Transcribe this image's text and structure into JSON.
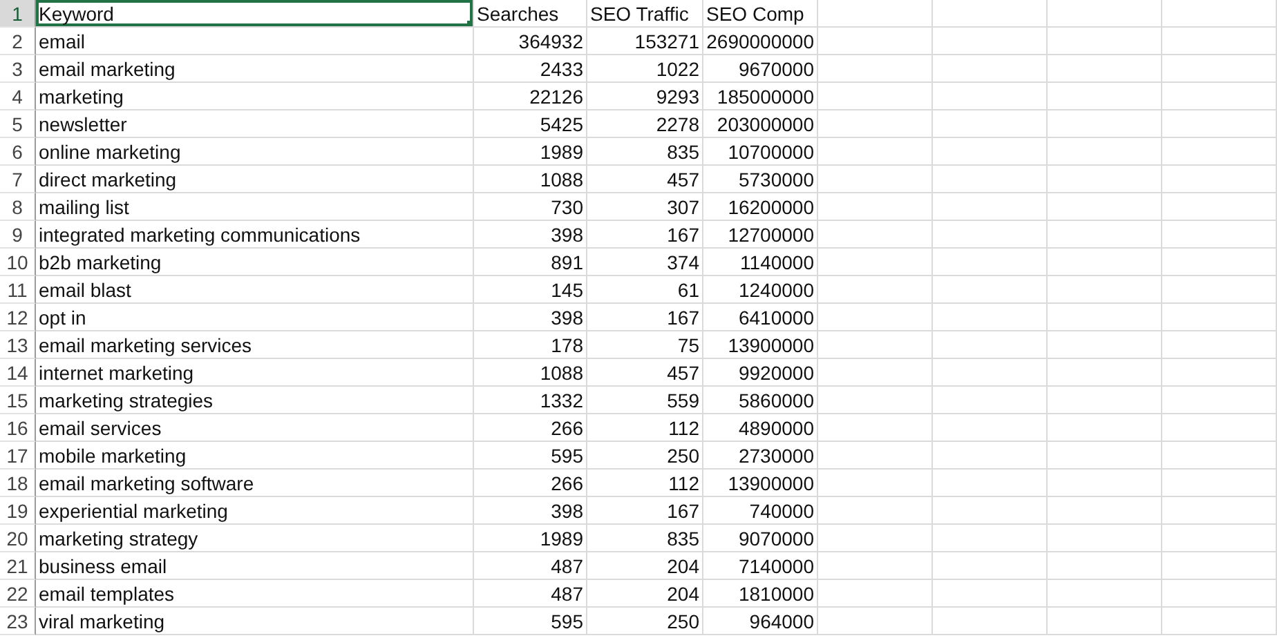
{
  "columns": [
    {
      "kind": "text"
    },
    {
      "kind": "number"
    },
    {
      "kind": "number"
    },
    {
      "kind": "number"
    }
  ],
  "rows": [
    {
      "number": "1",
      "kind": "header",
      "selected": true,
      "cells": [
        "Keyword",
        "Searches",
        "SEO Traffic",
        "SEO Comp"
      ]
    },
    {
      "number": "2",
      "kind": "data",
      "selected": false,
      "cells": [
        "email",
        "364932",
        "153271",
        "2690000000"
      ]
    },
    {
      "number": "3",
      "kind": "data",
      "selected": false,
      "cells": [
        "email marketing",
        "2433",
        "1022",
        "9670000"
      ]
    },
    {
      "number": "4",
      "kind": "data",
      "selected": false,
      "cells": [
        "marketing",
        "22126",
        "9293",
        "185000000"
      ]
    },
    {
      "number": "5",
      "kind": "data",
      "selected": false,
      "cells": [
        "newsletter",
        "5425",
        "2278",
        "203000000"
      ]
    },
    {
      "number": "6",
      "kind": "data",
      "selected": false,
      "cells": [
        "online marketing",
        "1989",
        "835",
        "10700000"
      ]
    },
    {
      "number": "7",
      "kind": "data",
      "selected": false,
      "cells": [
        "direct marketing",
        "1088",
        "457",
        "5730000"
      ]
    },
    {
      "number": "8",
      "kind": "data",
      "selected": false,
      "cells": [
        "mailing list",
        "730",
        "307",
        "16200000"
      ]
    },
    {
      "number": "9",
      "kind": "data",
      "selected": false,
      "cells": [
        "integrated marketing communications",
        "398",
        "167",
        "12700000"
      ]
    },
    {
      "number": "10",
      "kind": "data",
      "selected": false,
      "cells": [
        "b2b marketing",
        "891",
        "374",
        "1140000"
      ]
    },
    {
      "number": "11",
      "kind": "data",
      "selected": false,
      "cells": [
        "email blast",
        "145",
        "61",
        "1240000"
      ]
    },
    {
      "number": "12",
      "kind": "data",
      "selected": false,
      "cells": [
        "opt in",
        "398",
        "167",
        "6410000"
      ]
    },
    {
      "number": "13",
      "kind": "data",
      "selected": false,
      "cells": [
        "email marketing services",
        "178",
        "75",
        "13900000"
      ]
    },
    {
      "number": "14",
      "kind": "data",
      "selected": false,
      "cells": [
        "internet marketing",
        "1088",
        "457",
        "9920000"
      ]
    },
    {
      "number": "15",
      "kind": "data",
      "selected": false,
      "cells": [
        "marketing strategies",
        "1332",
        "559",
        "5860000"
      ]
    },
    {
      "number": "16",
      "kind": "data",
      "selected": false,
      "cells": [
        "email services",
        "266",
        "112",
        "4890000"
      ]
    },
    {
      "number": "17",
      "kind": "data",
      "selected": false,
      "cells": [
        "mobile marketing",
        "595",
        "250",
        "2730000"
      ]
    },
    {
      "number": "18",
      "kind": "data",
      "selected": false,
      "cells": [
        "email marketing software",
        "266",
        "112",
        "13900000"
      ]
    },
    {
      "number": "19",
      "kind": "data",
      "selected": false,
      "cells": [
        "experiential marketing",
        "398",
        "167",
        "740000"
      ]
    },
    {
      "number": "20",
      "kind": "data",
      "selected": false,
      "cells": [
        "marketing strategy",
        "1989",
        "835",
        "9070000"
      ]
    },
    {
      "number": "21",
      "kind": "data",
      "selected": false,
      "cells": [
        "business email",
        "487",
        "204",
        "7140000"
      ]
    },
    {
      "number": "22",
      "kind": "data",
      "selected": false,
      "cells": [
        "email templates",
        "487",
        "204",
        "1810000"
      ]
    },
    {
      "number": "23",
      "kind": "data",
      "selected": false,
      "cells": [
        "viral marketing",
        "595",
        "250",
        "964000"
      ]
    }
  ]
}
